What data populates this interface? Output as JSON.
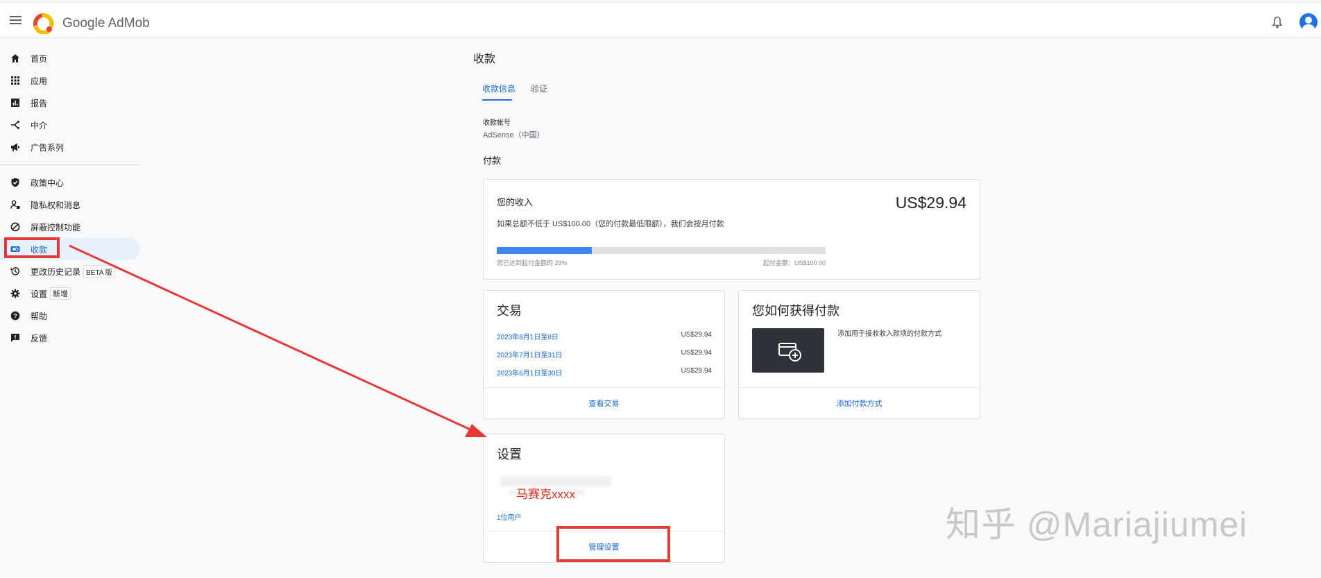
{
  "app": {
    "logo_text": "Google AdMob"
  },
  "nav": {
    "items": [
      {
        "label": "首页",
        "icon": "home-icon"
      },
      {
        "label": "应用",
        "icon": "apps-icon"
      },
      {
        "label": "报告",
        "icon": "reports-icon"
      },
      {
        "label": "中介",
        "icon": "mediation-icon"
      },
      {
        "label": "广告系列",
        "icon": "campaigns-icon"
      },
      {
        "label": "政策中心",
        "icon": "shield-icon"
      },
      {
        "label": "隐私权和消息",
        "icon": "privacy-icon"
      },
      {
        "label": "屏蔽控制功能",
        "icon": "block-icon"
      },
      {
        "label": "收款",
        "icon": "payments-icon"
      },
      {
        "label": "更改历史记录",
        "icon": "history-icon",
        "badge": "BETA 版"
      },
      {
        "label": "设置",
        "icon": "gear-icon",
        "badge": "新增"
      },
      {
        "label": "帮助",
        "icon": "help-icon"
      },
      {
        "label": "反馈",
        "icon": "feedback-icon"
      }
    ]
  },
  "page": {
    "title": "收款",
    "tabs": [
      {
        "label": "收款信息"
      },
      {
        "label": "验证"
      }
    ],
    "account_label": "收款帐号",
    "account_value": "AdSense（中国）",
    "section_title": "付款"
  },
  "earnings": {
    "title": "您的收入",
    "amount": "US$29.94",
    "description": "如果总额不低于 US$100.00（您的付款最低限额），我们会按月付款",
    "progress_label": "您已达到起付金额的 29%",
    "threshold_label": "起付金额：US$100.00",
    "progress_fraction": 0.29
  },
  "transactions": {
    "title": "交易",
    "rows": [
      {
        "date": "2023年8月1日至8日",
        "amount": "US$29.94"
      },
      {
        "date": "2023年7月1日至31日",
        "amount": "US$29.94"
      },
      {
        "date": "2023年6月1日至30日",
        "amount": "US$29.94"
      }
    ],
    "footer_link": "查看交易"
  },
  "how_to_get_paid": {
    "title": "您如何获得付款",
    "description": "添加用于接收收入款项的付款方式",
    "footer_link": "添加付款方式"
  },
  "settings_card": {
    "title": "设置",
    "name": "马赛克xxxx",
    "users": "1位用户",
    "footer_link": "管理设置"
  },
  "watermark": "知乎 @Mariajiumei",
  "colors": {
    "accent": "#1a73e8",
    "annotation": "#e53935",
    "link": "#1967d2"
  }
}
